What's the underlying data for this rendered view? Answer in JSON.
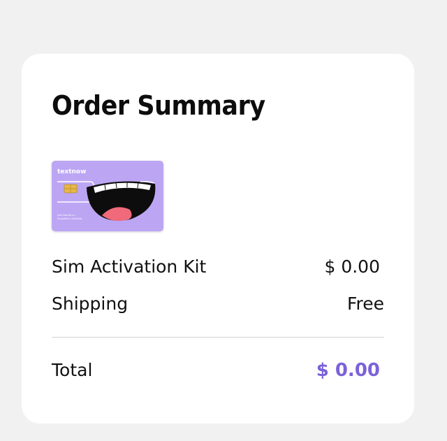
{
  "order_summary": {
    "title": "Order Summary",
    "product_image": {
      "brand": "textnow",
      "tagline": "Get Shared in. Anywhere, Anytime.",
      "background_color": "#bca6f3"
    },
    "line_items": [
      {
        "label": "Sim Activation Kit",
        "value": "$ 0.00"
      },
      {
        "label": "Shipping",
        "value": "Free"
      }
    ],
    "total": {
      "label": "Total",
      "value": "$ 0.00",
      "color": "#7b62d8"
    }
  }
}
